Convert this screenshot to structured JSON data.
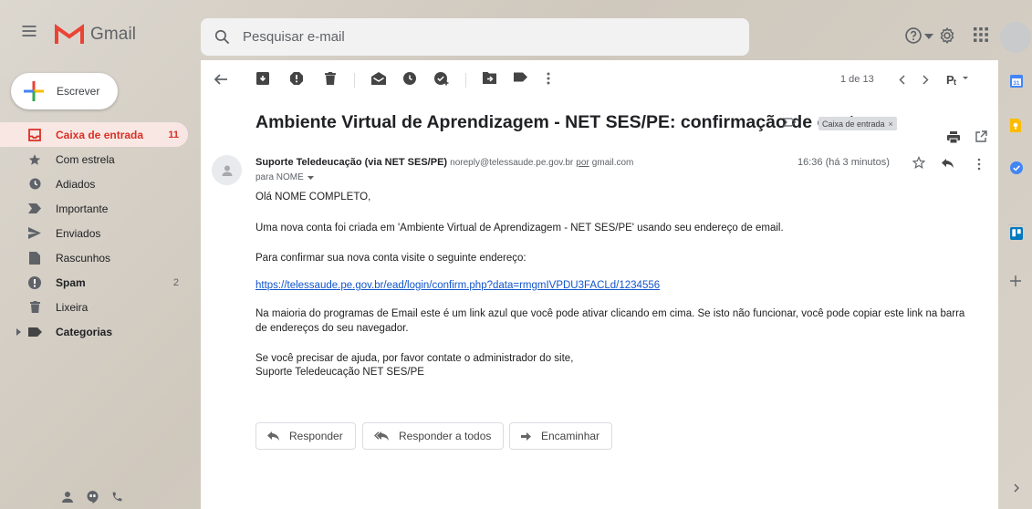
{
  "app": {
    "name": "Gmail"
  },
  "search": {
    "placeholder": "Pesquisar e-mail"
  },
  "compose": {
    "label": "Escrever"
  },
  "sidebar": {
    "items": [
      {
        "label": "Caixa de entrada",
        "count": "11",
        "icon": "inbox-icon"
      },
      {
        "label": "Com estrela",
        "count": "",
        "icon": "star-icon"
      },
      {
        "label": "Adiados",
        "count": "",
        "icon": "clock-icon"
      },
      {
        "label": "Importante",
        "count": "",
        "icon": "important-icon"
      },
      {
        "label": "Enviados",
        "count": "",
        "icon": "send-icon"
      },
      {
        "label": "Rascunhos",
        "count": "",
        "icon": "draft-icon"
      },
      {
        "label": "Spam",
        "count": "2",
        "icon": "spam-icon"
      },
      {
        "label": "Lixeira",
        "count": "",
        "icon": "trash-icon"
      },
      {
        "label": "Categorias",
        "count": "",
        "icon": "label-icon"
      }
    ]
  },
  "toolbar": {
    "pager": "1 de 13"
  },
  "email": {
    "subject": "Ambiente Virtual de Aprendizagem - NET SES/PE: confirmação de conta",
    "label_chip": "Caixa de entrada",
    "label_chip_close": "×",
    "sender_name": "Suporte Teledeucação (via NET SES/PE)",
    "sender_email": "noreply@telessaude.pe.gov.br",
    "via_word": "por",
    "via_domain": "gmail.com",
    "to": "para NOME",
    "time": "16:36 (há 3 minutos)",
    "greeting": "Olá NOME COMPLETO,",
    "p1": "Uma nova conta foi criada em 'Ambiente Virtual de Aprendizagem - NET SES/PE' usando seu endereço de email.",
    "p2": "Para confirmar sua nova conta visite o seguinte endereço:",
    "link": "https://telessaude.pe.gov.br/ead/login/confirm.php?data=rmgmIVPDU3FACLd/1234556",
    "p3": "Na maioria do programas de Email este é um link azul que você pode ativar clicando em cima. Se isto não funcionar, você pode copiar este link na barra de endereços do seu navegador.",
    "p4a": "Se você precisar de ajuda, por favor contate o administrador do site,",
    "p4b": "Suporte Teledeucação NET SES/PE"
  },
  "actions": {
    "reply": "Responder",
    "reply_all": "Responder a todos",
    "forward": "Encaminhar"
  },
  "colors": {
    "accent": "#d93025",
    "link": "#1155cc",
    "active_bg": "#fce8e6"
  }
}
